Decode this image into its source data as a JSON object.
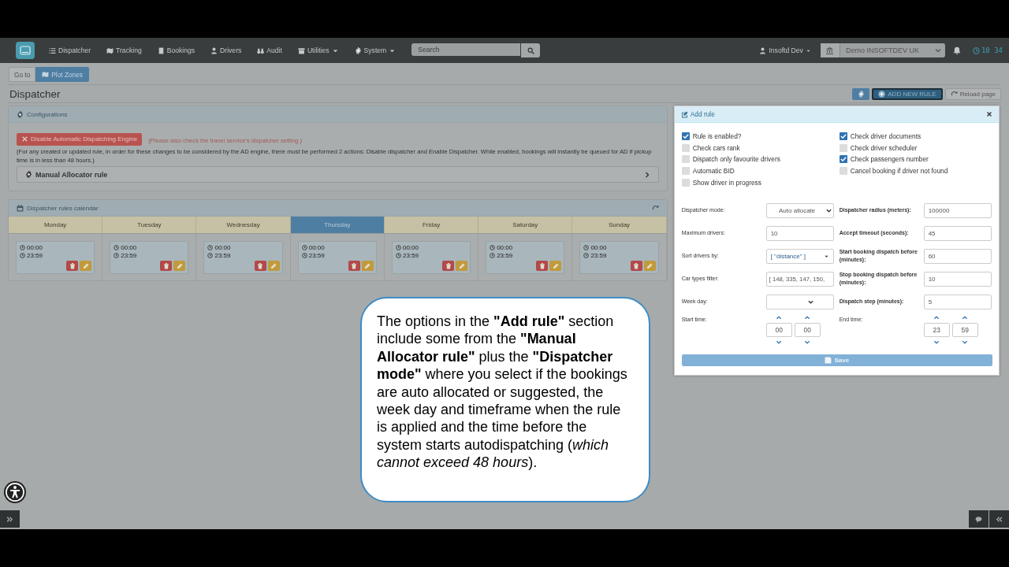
{
  "navbar": {
    "items": [
      {
        "label": "Dispatcher",
        "dropdown": false
      },
      {
        "label": "Tracking",
        "dropdown": false
      },
      {
        "label": "Bookings",
        "dropdown": false
      },
      {
        "label": "Drivers",
        "dropdown": false
      },
      {
        "label": "Audit",
        "dropdown": false
      },
      {
        "label": "Utilities",
        "dropdown": true
      },
      {
        "label": "System",
        "dropdown": true
      }
    ],
    "search": {
      "placeholder": "Search"
    },
    "user": "Insoftd Dev",
    "company": "Demo INSOFTDEV UK",
    "clock": "10 34"
  },
  "toolbar": {
    "goto": "Go to",
    "plot_button": "Plot Zones"
  },
  "header": {
    "title": "Dispatcher",
    "add_button": "ADD NEW RULE",
    "reload_button": "Reload page"
  },
  "config": {
    "title": "Configurations",
    "disable_button": "Disable Automatic Dispatching Engine",
    "warning": "(Please also check the travel service's dispatcher setting.)",
    "note": "(For any created or updated rule, in order for these changes to be considered by the AD engine, there must be performed 2 actions: Disable dispatcher and Enable Dispatcher. While enabled, bookings will instantly be queued for AD if pickup time is in less than 48 hours.)",
    "accordion": "Manual Allocator rule"
  },
  "calendar": {
    "title": "Dispatcher rules calendar",
    "days": [
      {
        "name": "Monday",
        "selected": false,
        "rules": [
          {
            "start": "00:00",
            "end": "23:59"
          }
        ]
      },
      {
        "name": "Tuesday",
        "selected": false,
        "rules": [
          {
            "start": "00:00",
            "end": "23:59"
          }
        ]
      },
      {
        "name": "Wednesday",
        "selected": false,
        "rules": [
          {
            "start": "00:00",
            "end": "23:59"
          }
        ]
      },
      {
        "name": "Thursday",
        "selected": true,
        "rules": [
          {
            "start": "00:00",
            "end": "23:59"
          }
        ]
      },
      {
        "name": "Friday",
        "selected": false,
        "rules": [
          {
            "start": "00:00",
            "end": "23:59"
          }
        ]
      },
      {
        "name": "Saturday",
        "selected": false,
        "rules": [
          {
            "start": "00:00",
            "end": "23:59"
          }
        ]
      },
      {
        "name": "Sunday",
        "selected": false,
        "rules": [
          {
            "start": "00:00",
            "end": "23:59"
          }
        ]
      }
    ]
  },
  "add_rule": {
    "title": "Add rule",
    "options_left": [
      {
        "label": "Rule is enabled?",
        "checked": true
      },
      {
        "label": "Check cars rank",
        "checked": false
      },
      {
        "label": "Dispatch only favourite drivers",
        "checked": false
      },
      {
        "label": "Automatic BID",
        "checked": false
      },
      {
        "label": "Show driver in progress",
        "checked": false
      }
    ],
    "options_right": [
      {
        "label": "Check driver documents",
        "checked": true
      },
      {
        "label": "Check driver scheduler",
        "checked": false
      },
      {
        "label": "Check passengers number",
        "checked": true
      },
      {
        "label": "Cancel booking if driver not found",
        "checked": false
      }
    ],
    "fields_left": [
      {
        "label": "Dispatcher mode:",
        "value": "Auto allocate",
        "kind": "select"
      },
      {
        "label": "Maximum drivers:",
        "value": "10",
        "kind": "input"
      },
      {
        "label": "Sort drivers by:",
        "value": "[ \"distance\" ]",
        "kind": "list"
      },
      {
        "label": "Car types filter:",
        "value": "[ 148, 335, 147, 150,",
        "kind": "list_text"
      },
      {
        "label": "Week day:",
        "kind": "select"
      }
    ],
    "fields_right": [
      {
        "label": "Dispatcher radius (meters):",
        "value": "100000"
      },
      {
        "label": "Accept timeout (seconds):",
        "value": "45"
      },
      {
        "label": "Start booking dispatch before (minutes):",
        "value": "60"
      },
      {
        "label": "Stop booking dispatch before (minutes):",
        "value": "10"
      },
      {
        "label": "Dispatch step (minutes):",
        "value": "5"
      }
    ],
    "times": [
      {
        "label": "Start time:",
        "hour": "00",
        "minute": "00"
      },
      {
        "label": "End time:",
        "hour": "23",
        "minute": "59"
      }
    ],
    "save": "Save"
  },
  "callout": {
    "text": "The options in the **\"Add rule\"** section include some from the **\"Manual Allocator rule\"** plus the **\"Dispatcher mode\"** where you select if the bookings are auto allocated or suggested, the week day and timeframe when the rule is applied and the time before the system starts autodispatching (*which cannot exceed 48 hours*)."
  }
}
